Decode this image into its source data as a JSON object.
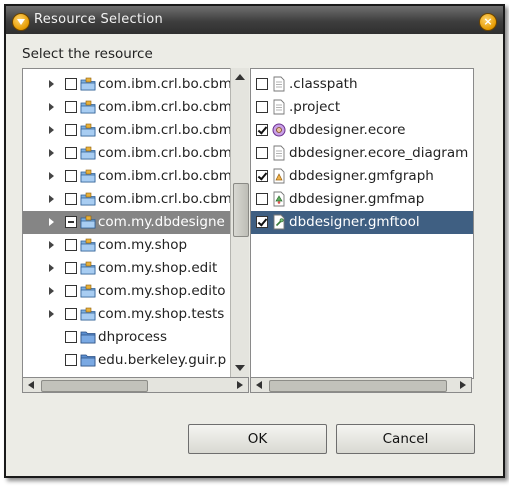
{
  "window": {
    "title": "Resource Selection",
    "title_icon": "app-badge-icon",
    "close_icon": "close-icon"
  },
  "prompt": "Select the resource",
  "left_tree": {
    "items": [
      {
        "label": "com.ibm.crl.bo.cbm",
        "icon": "package-folder-icon",
        "expandable": true,
        "check": "unchecked",
        "selected": false
      },
      {
        "label": "com.ibm.crl.bo.cbm",
        "icon": "package-folder-icon",
        "expandable": true,
        "check": "unchecked",
        "selected": false
      },
      {
        "label": "com.ibm.crl.bo.cbm",
        "icon": "package-folder-icon",
        "expandable": true,
        "check": "unchecked",
        "selected": false
      },
      {
        "label": "com.ibm.crl.bo.cbm",
        "icon": "package-folder-icon",
        "expandable": true,
        "check": "unchecked",
        "selected": false
      },
      {
        "label": "com.ibm.crl.bo.cbm",
        "icon": "package-folder-icon",
        "expandable": true,
        "check": "unchecked",
        "selected": false
      },
      {
        "label": "com.ibm.crl.bo.cbm",
        "icon": "package-folder-icon",
        "expandable": true,
        "check": "unchecked",
        "selected": false
      },
      {
        "label": "com.my.dbdesigne",
        "icon": "package-folder-icon",
        "expandable": true,
        "check": "partial",
        "selected": true
      },
      {
        "label": "com.my.shop",
        "icon": "package-folder-icon",
        "expandable": true,
        "check": "unchecked",
        "selected": false
      },
      {
        "label": "com.my.shop.edit",
        "icon": "package-folder-icon",
        "expandable": true,
        "check": "unchecked",
        "selected": false
      },
      {
        "label": "com.my.shop.edito",
        "icon": "package-folder-icon",
        "expandable": true,
        "check": "unchecked",
        "selected": false
      },
      {
        "label": "com.my.shop.tests",
        "icon": "package-folder-icon",
        "expandable": true,
        "check": "unchecked",
        "selected": false
      },
      {
        "label": "dhprocess",
        "icon": "folder-icon",
        "expandable": false,
        "check": "unchecked",
        "selected": false
      },
      {
        "label": "edu.berkeley.guir.p",
        "icon": "folder-icon",
        "expandable": false,
        "check": "unchecked",
        "selected": false
      }
    ]
  },
  "right_list": {
    "items": [
      {
        "label": ".classpath",
        "icon": "text-file-icon",
        "checked": false,
        "selected": false
      },
      {
        "label": ".project",
        "icon": "text-file-icon",
        "checked": false,
        "selected": false
      },
      {
        "label": "dbdesigner.ecore",
        "icon": "ecore-model-icon",
        "checked": true,
        "selected": false
      },
      {
        "label": "dbdesigner.ecore_diagram",
        "icon": "text-file-icon",
        "checked": false,
        "selected": false
      },
      {
        "label": "dbdesigner.gmfgraph",
        "icon": "gmfgraph-file-icon",
        "checked": true,
        "selected": false
      },
      {
        "label": "dbdesigner.gmfmap",
        "icon": "gmfmap-file-icon",
        "checked": false,
        "selected": false
      },
      {
        "label": "dbdesigner.gmftool",
        "icon": "gmftool-file-icon",
        "checked": true,
        "selected": true
      }
    ]
  },
  "buttons": {
    "ok": "OK",
    "cancel": "Cancel"
  },
  "colors": {
    "selection_grey": "#858585",
    "selection_blue": "#3f5f82",
    "dialog_bg": "#ecece6"
  }
}
